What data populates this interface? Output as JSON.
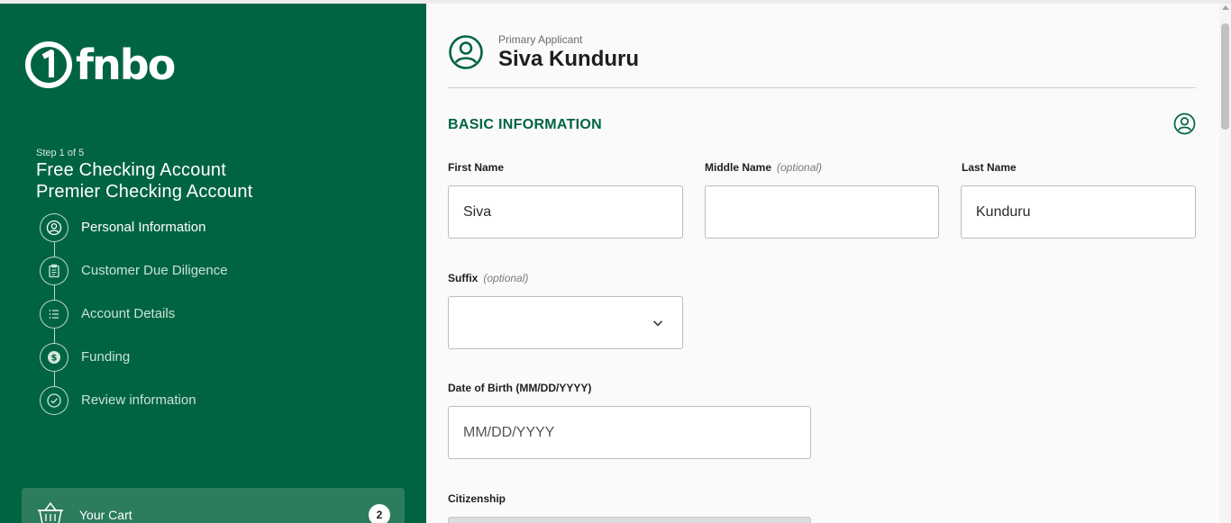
{
  "brand": {
    "name": "fnbo",
    "logo_icon": "fnbo-one-mark",
    "primary_color": "#006442"
  },
  "sidebar": {
    "step_count": "Step 1 of 5",
    "products": [
      "Free Checking Account",
      "Premier Checking Account"
    ],
    "steps": [
      {
        "label": "Personal Information",
        "icon": "user-circle-icon",
        "active": true
      },
      {
        "label": "Customer Due Diligence",
        "icon": "clipboard-icon",
        "active": false
      },
      {
        "label": "Account Details",
        "icon": "list-icon",
        "active": false
      },
      {
        "label": "Funding",
        "icon": "dollar-icon",
        "active": false
      },
      {
        "label": "Review information",
        "icon": "check-circle-icon",
        "active": false
      }
    ],
    "cart": {
      "label": "Your Cart",
      "count": "2",
      "icon": "basket-icon"
    }
  },
  "header": {
    "subtitle": "Primary Applicant",
    "name": "Siva Kunduru",
    "icon": "user-circle-icon"
  },
  "section": {
    "title": "BASIC INFORMATION",
    "icon": "user-circle-icon"
  },
  "form": {
    "optional_text": "(optional)",
    "first_name": {
      "label": "First Name",
      "value": "Siva"
    },
    "middle_name": {
      "label": "Middle Name",
      "value": ""
    },
    "last_name": {
      "label": "Last Name",
      "value": "Kunduru"
    },
    "suffix": {
      "label": "Suffix",
      "value": ""
    },
    "dob": {
      "label": "Date of Birth (MM/DD/YYYY)",
      "placeholder": "MM/DD/YYYY"
    },
    "citizenship": {
      "label": "Citizenship"
    }
  }
}
